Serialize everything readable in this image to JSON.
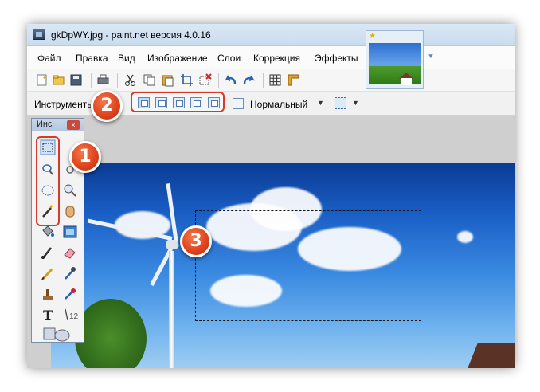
{
  "window": {
    "title": "gkDpWY.jpg - paint.net версия 4.0.16"
  },
  "menu": [
    "Файл",
    "Правка",
    "Вид",
    "Изображение",
    "Слои",
    "Коррекция",
    "Эффекты"
  ],
  "toolbar": {
    "icons": [
      "new-icon",
      "open-icon",
      "save-icon",
      "print-icon",
      "cut-icon",
      "copy-icon",
      "paste-icon",
      "crop-icon",
      "deselect-icon",
      "undo-icon",
      "redo-icon",
      "grid-icon",
      "ruler-icon"
    ]
  },
  "tool_options": {
    "label": "Инструменты",
    "selection_modes": [
      "replace-mode",
      "union-mode",
      "exclude-mode",
      "intersect-mode",
      "xor-mode"
    ],
    "blend_mode": "Нормальный"
  },
  "tools_panel": {
    "title": "Инс",
    "close_label": "×",
    "tools": [
      "rectangle-select",
      "move-selection",
      "lasso-select",
      "move-selection-2",
      "ellipse-select",
      "zoom",
      "magic-wand",
      "pan",
      "paint-bucket",
      "gradient",
      "paintbrush",
      "eraser",
      "pencil",
      "color-picker",
      "clone-stamp",
      "recolor",
      "text",
      "line-curve",
      "shapes"
    ]
  },
  "badges": [
    "1",
    "2",
    "3"
  ],
  "colors": {
    "badge": "#e0451f",
    "highlight": "#d83a2a",
    "accent": "#5c88bd"
  }
}
